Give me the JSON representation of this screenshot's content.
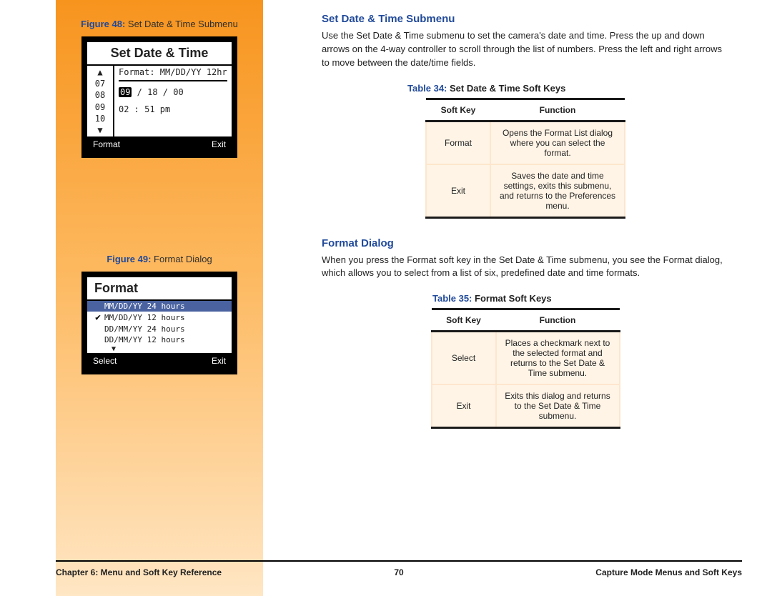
{
  "figure48": {
    "label_prefix": "Figure 48:",
    "label_text": " Set Date & Time Submenu"
  },
  "lcd1": {
    "title": "Set Date & Time",
    "col_numbers": "▲\n07\n08\n09\n10\n▼",
    "format_line": "Format: MM/DD/YY 12hr",
    "date_hl": "09",
    "date_rest": " / 18 / 00",
    "time_line": "02 : 51   pm",
    "foot_left": "Format",
    "foot_right": "Exit"
  },
  "figure49": {
    "label_prefix": "Figure 49:",
    "label_text": " Format Dialog"
  },
  "lcd2": {
    "title": "Format",
    "opt1": "MM/DD/YY 24 hours",
    "opt2": "MM/DD/YY 12 hours",
    "opt3": "DD/MM/YY 24 hours",
    "opt4": "DD/MM/YY 12 hours",
    "arrow": "▼",
    "foot_left": "Select",
    "foot_right": "Exit"
  },
  "section1": {
    "heading": "Set Date & Time Submenu",
    "para": "Use the Set Date & Time submenu to set the camera's date and time. Press the up and down arrows on the 4-way controller to scroll through the list of numbers. Press the left and right arrows to move between the date/time fields."
  },
  "table34": {
    "caption_prefix": "Table 34:",
    "caption_text": " Set Date & Time Soft Keys",
    "h1": "Soft Key",
    "h2": "Function",
    "r1k": "Format",
    "r1v": "Opens the Format List dialog where you can select the format.",
    "r2k": "Exit",
    "r2v": "Saves the date and time settings, exits this submenu, and returns to the Preferences menu."
  },
  "section2": {
    "heading": "Format Dialog",
    "para": "When you press the Format soft key in the Set Date & Time submenu, you see the Format dialog, which allows you to select from a list of six, predefined date and time formats."
  },
  "table35": {
    "caption_prefix": "Table 35:",
    "caption_text": " Format Soft Keys",
    "h1": "Soft Key",
    "h2": "Function",
    "r1k": "Select",
    "r1v": "Places a checkmark next to the selected format and returns to the Set Date & Time submenu.",
    "r2k": "Exit",
    "r2v": "Exits this dialog and returns to the Set Date & Time submenu."
  },
  "footer": {
    "left": "Chapter 6: Menu and Soft Key Reference",
    "page": "70",
    "right": "Capture Mode Menus and Soft Keys"
  }
}
